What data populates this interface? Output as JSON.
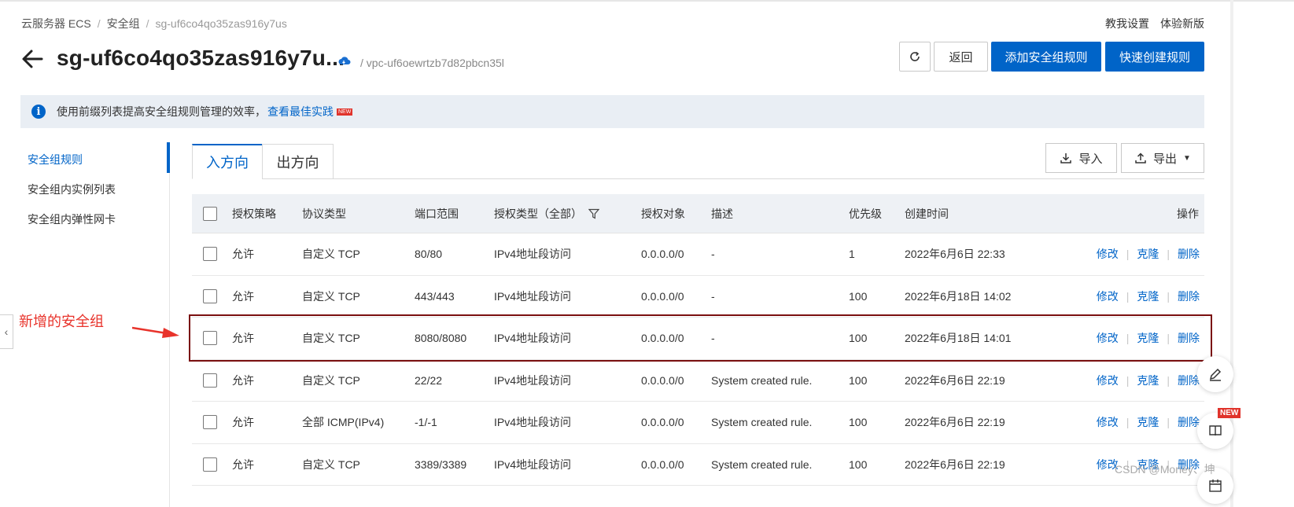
{
  "breadcrumb": {
    "items": [
      "云服务器 ECS",
      "安全组"
    ],
    "current": "sg-uf6co4qo35zas916y7us"
  },
  "header_links": [
    "教我设置",
    "体验新版"
  ],
  "title": "sg-uf6co4qo35zas916y7u...",
  "vpc_label": "/ vpc-uf6oewrtzb7d82pbcn35l",
  "actions": {
    "back": "返回",
    "add_rule": "添加安全组规则",
    "quick_create": "快速创建规则"
  },
  "info_bar": {
    "text": "使用前缀列表提高安全组规则管理的效率，",
    "link": "查看最佳实践",
    "badge": "NEW"
  },
  "sidebar": {
    "items": [
      "安全组规则",
      "安全组内实例列表",
      "安全组内弹性网卡"
    ]
  },
  "tabs": [
    "入方向",
    "出方向"
  ],
  "tools": {
    "import": "导入",
    "export": "导出"
  },
  "table": {
    "headers": {
      "policy": "授权策略",
      "protocol": "协议类型",
      "port": "端口范围",
      "auth_type": "授权类型（全部）",
      "auth_object": "授权对象",
      "description": "描述",
      "priority": "优先级",
      "created": "创建时间",
      "ops": "操作"
    },
    "ops_labels": {
      "edit": "修改",
      "clone": "克隆",
      "delete": "删除"
    },
    "rows": [
      {
        "policy": "允许",
        "protocol": "自定义 TCP",
        "port": "80/80",
        "auth_type": "IPv4地址段访问",
        "auth_object": "0.0.0.0/0",
        "description": "-",
        "priority": "1",
        "created": "2022年6月6日 22:33"
      },
      {
        "policy": "允许",
        "protocol": "自定义 TCP",
        "port": "443/443",
        "auth_type": "IPv4地址段访问",
        "auth_object": "0.0.0.0/0",
        "description": "-",
        "priority": "100",
        "created": "2022年6月18日 14:02"
      },
      {
        "policy": "允许",
        "protocol": "自定义 TCP",
        "port": "8080/8080",
        "auth_type": "IPv4地址段访问",
        "auth_object": "0.0.0.0/0",
        "description": "-",
        "priority": "100",
        "created": "2022年6月18日 14:01"
      },
      {
        "policy": "允许",
        "protocol": "自定义 TCP",
        "port": "22/22",
        "auth_type": "IPv4地址段访问",
        "auth_object": "0.0.0.0/0",
        "description": "System created rule.",
        "priority": "100",
        "created": "2022年6月6日 22:19"
      },
      {
        "policy": "允许",
        "protocol": "全部 ICMP(IPv4)",
        "port": "-1/-1",
        "auth_type": "IPv4地址段访问",
        "auth_object": "0.0.0.0/0",
        "description": "System created rule.",
        "priority": "100",
        "created": "2022年6月6日 22:19"
      },
      {
        "policy": "允许",
        "protocol": "自定义 TCP",
        "port": "3389/3389",
        "auth_type": "IPv4地址段访问",
        "auth_object": "0.0.0.0/0",
        "description": "System created rule.",
        "priority": "100",
        "created": "2022年6月6日 22:19"
      }
    ]
  },
  "annotation": "新增的安全组",
  "float_badge": "NEW",
  "watermark": "CSDN @Money、坤",
  "colors": {
    "primary": "#0064c8",
    "annotation": "#e8332b",
    "highlight_border": "#7a0f0f"
  }
}
